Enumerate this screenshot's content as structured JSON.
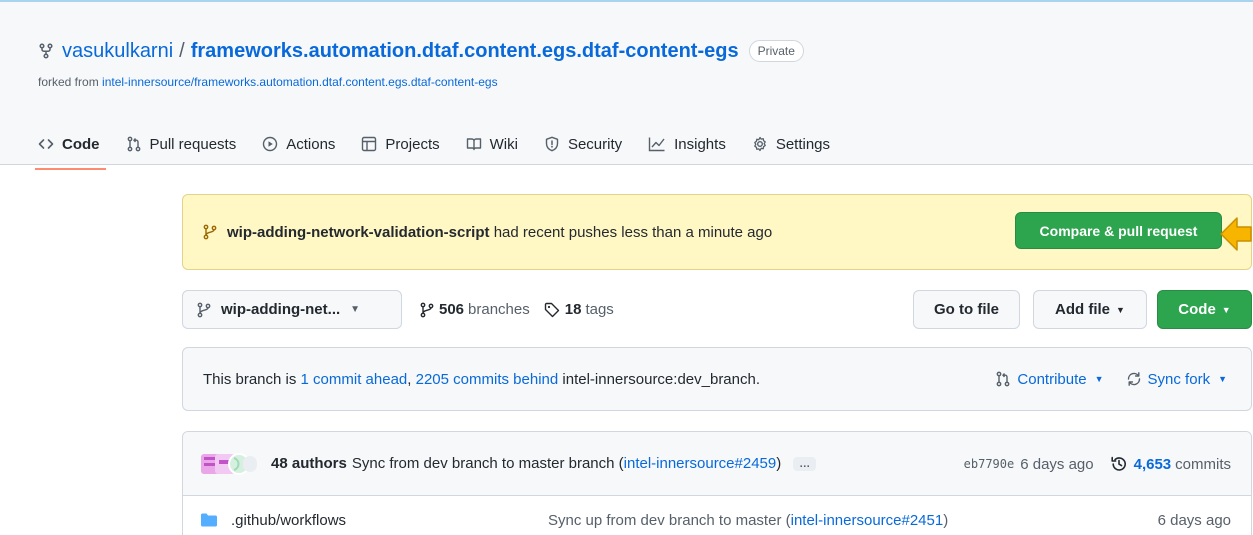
{
  "repo": {
    "owner": "vasukulkarni",
    "separator": "/",
    "name": "frameworks.automation.dtaf.content.egs.dtaf-content-egs",
    "visibility": "Private",
    "forked_prefix": "forked from",
    "forked_from": "intel-innersource/frameworks.automation.dtaf.content.egs.dtaf-content-egs"
  },
  "tabs": [
    {
      "label": "Code",
      "icon": "code-icon"
    },
    {
      "label": "Pull requests",
      "icon": "pull-request-icon"
    },
    {
      "label": "Actions",
      "icon": "play-icon"
    },
    {
      "label": "Projects",
      "icon": "table-icon"
    },
    {
      "label": "Wiki",
      "icon": "book-icon"
    },
    {
      "label": "Security",
      "icon": "shield-icon"
    },
    {
      "label": "Insights",
      "icon": "graph-icon"
    },
    {
      "label": "Settings",
      "icon": "gear-icon"
    }
  ],
  "banner": {
    "branch": "wip-adding-network-validation-script",
    "message": "had recent pushes less than a minute ago",
    "button": "Compare & pull request"
  },
  "branch_bar": {
    "selected_branch": "wip-adding-net...",
    "branches_count": "506",
    "branches_label": "branches",
    "tags_count": "18",
    "tags_label": "tags",
    "go_to_file": "Go to file",
    "add_file": "Add file",
    "code": "Code"
  },
  "status": {
    "prefix": "This branch is",
    "ahead": "1 commit ahead",
    "comma": ",",
    "behind": "2205 commits behind",
    "target": "intel-innersource:dev_branch.",
    "contribute": "Contribute",
    "sync": "Sync fork"
  },
  "latest_commit": {
    "authors": "48 authors",
    "message": "Sync from dev branch to master branch (",
    "ref": "intel-innersource#2459",
    "close": ")",
    "ellipsis": "…",
    "sha": "eb7790e",
    "age": "6 days ago",
    "commit_count": "4,653",
    "commits_label": "commits"
  },
  "files": [
    {
      "name": ".github/workflows",
      "message": "Sync up from dev branch to master (",
      "ref": "intel-innersource#2451",
      "close": ")",
      "age": "6 days ago"
    }
  ],
  "colors": {
    "accent": "#0969da",
    "green": "#2da44e",
    "banner_bg": "#fff8c5",
    "arrow": "#f7b500"
  }
}
